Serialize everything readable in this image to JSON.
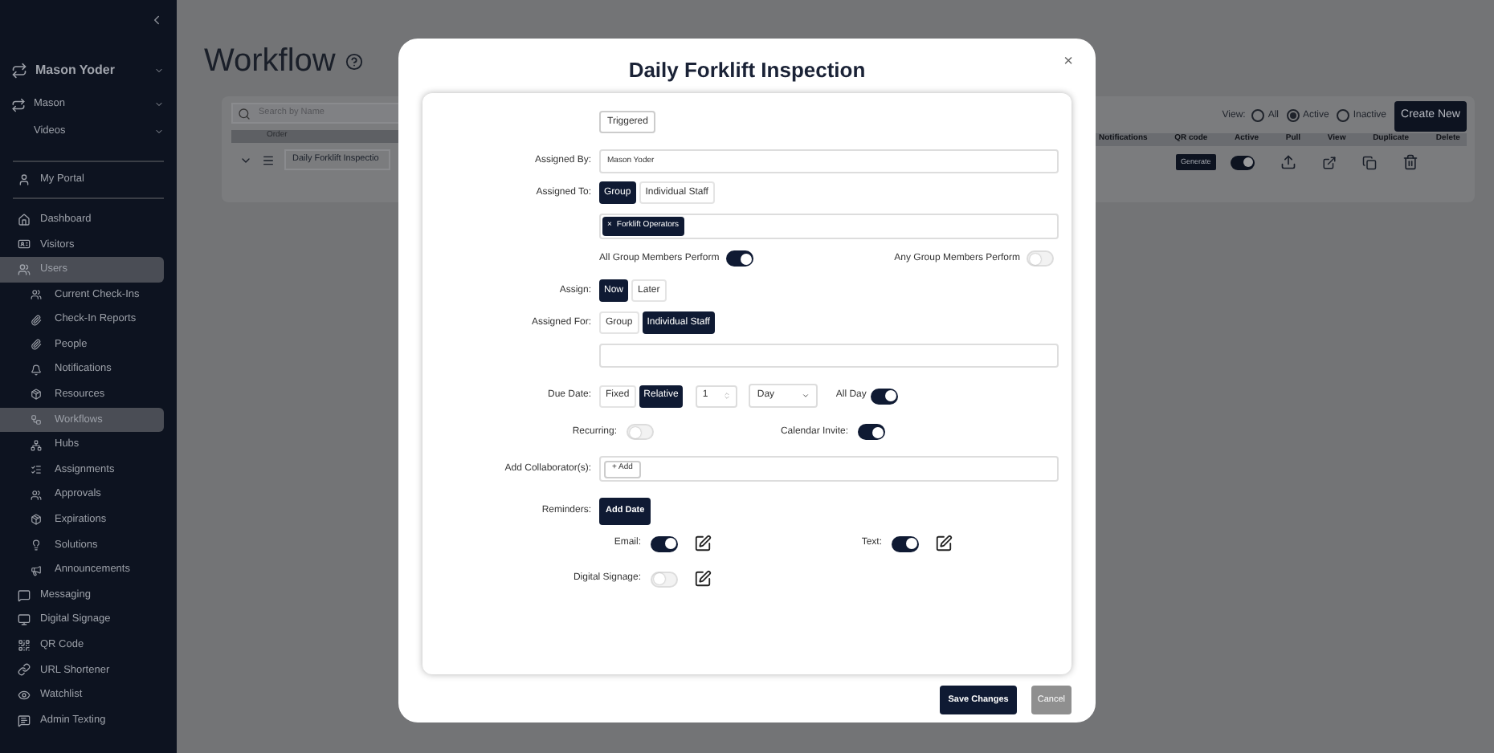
{
  "sidebar": {
    "account": {
      "name": "Mason Yoder",
      "org": "Mason",
      "channel": "Videos"
    },
    "portal": {
      "label": "My Portal"
    },
    "items": [
      {
        "label": "Dashboard",
        "selected": false
      },
      {
        "label": "Visitors",
        "selected": false
      },
      {
        "label": "Users",
        "selected": true,
        "children": [
          {
            "label": "Current Check-Ins",
            "selected": false
          },
          {
            "label": "Check-In Reports",
            "selected": false
          },
          {
            "label": "People",
            "selected": false
          },
          {
            "label": "Notifications",
            "selected": false
          },
          {
            "label": "Resources",
            "selected": false
          },
          {
            "label": "Workflows",
            "selected": true
          },
          {
            "label": "Hubs",
            "selected": false
          },
          {
            "label": "Assignments",
            "selected": false
          },
          {
            "label": "Approvals",
            "selected": false
          },
          {
            "label": "Expirations",
            "selected": false
          },
          {
            "label": "Solutions",
            "selected": false
          },
          {
            "label": "Announcements",
            "selected": false
          }
        ]
      },
      {
        "label": "Messaging",
        "selected": false
      },
      {
        "label": "Digital Signage",
        "selected": false
      },
      {
        "label": "QR Code",
        "selected": false
      },
      {
        "label": "URL Shortener",
        "selected": false
      },
      {
        "label": "Watchlist",
        "selected": false
      },
      {
        "label": "Admin Texting",
        "selected": false
      }
    ]
  },
  "page": {
    "title": "Workflow",
    "search": {
      "placeholder": "Search by Name"
    },
    "view": {
      "label": "View:",
      "options": [
        {
          "label": "All",
          "selected": false
        },
        {
          "label": "Active",
          "selected": true
        },
        {
          "label": "Inactive",
          "selected": false
        }
      ]
    },
    "create_button": "Create New",
    "columns_left": [
      "Order"
    ],
    "columns_right": [
      "Notifications",
      "QR code",
      "Active",
      "Pull",
      "View",
      "Duplicate",
      "Delete"
    ],
    "row": {
      "name": "Daily Forklift Inspectio",
      "qr_button": "Generate",
      "active": true
    }
  },
  "modal": {
    "title": "Daily Forklift Inspection",
    "close": "×",
    "trigger_button": "Triggered",
    "assigned_by": {
      "label": "Assigned By:",
      "value": "Mason Yoder"
    },
    "assigned_to": {
      "label": "Assigned To:",
      "options": [
        {
          "label": "Group",
          "selected": true
        },
        {
          "label": "Individual Staff",
          "selected": false
        }
      ],
      "tags": [
        {
          "label": "Forklift Operators",
          "remove": "×"
        }
      ]
    },
    "perform": [
      {
        "label": "All Group Members Perform",
        "on": true
      },
      {
        "label": "Any Group Members Perform",
        "on": false
      }
    ],
    "assign": {
      "label": "Assign:",
      "options": [
        {
          "label": "Now",
          "selected": true
        },
        {
          "label": "Later",
          "selected": false
        }
      ]
    },
    "assigned_for": {
      "label": "Assigned For:",
      "options": [
        {
          "label": "Group",
          "selected": false
        },
        {
          "label": "Individual Staff",
          "selected": true
        }
      ]
    },
    "due_date": {
      "label": "Due Date:",
      "options": [
        {
          "label": "Fixed",
          "selected": false
        },
        {
          "label": "Relative",
          "selected": true
        }
      ],
      "amount": "1",
      "unit": "Day",
      "all_day": {
        "label": "All Day",
        "on": true
      }
    },
    "recurring": {
      "label": "Recurring:",
      "on": false
    },
    "calendar_invite": {
      "label": "Calendar Invite:",
      "on": true
    },
    "collaborators": {
      "label": "Add Collaborator(s):",
      "add_button": "+ Add"
    },
    "reminders": {
      "label": "Reminders:",
      "button": "Add Date"
    },
    "channels": [
      {
        "label": "Email:",
        "on": true
      },
      {
        "label": "Text:",
        "on": true
      },
      {
        "label": "Digital Signage:",
        "on": false
      }
    ],
    "save_button": "Save Changes",
    "cancel_button": {
      "label": "Cancel",
      "disabled": true
    }
  }
}
